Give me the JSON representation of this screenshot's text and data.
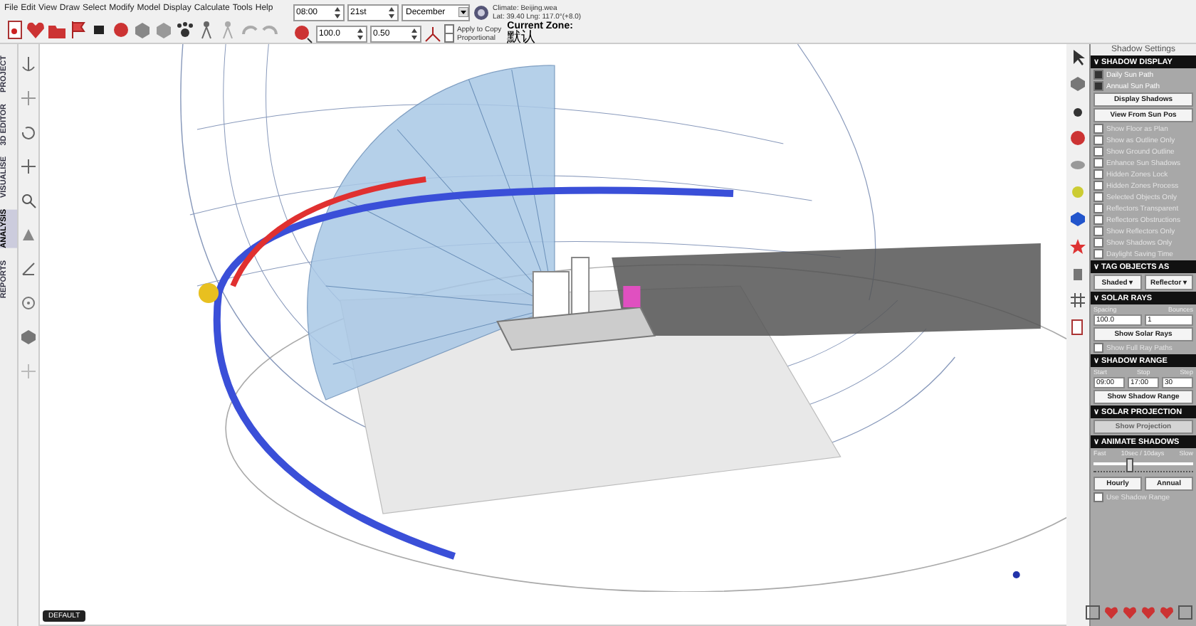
{
  "menu": [
    "File",
    "Edit",
    "View",
    "Draw",
    "Select",
    "Modify",
    "Model",
    "Display",
    "Calculate",
    "Tools",
    "Help"
  ],
  "date": {
    "time": "08:00",
    "day": "21st",
    "month": "December"
  },
  "climate": {
    "file": "Climate: Beijing.wea",
    "location": "Lat: 39.40   Lng: 117.0°(+8.0)"
  },
  "transform": {
    "scale": "100.0",
    "factor": "0.50",
    "apply_to_copy": {
      "label": "Apply to Copy",
      "checked": false
    },
    "proportional": {
      "label": "Proportional",
      "checked": false
    }
  },
  "zone": {
    "label": "Current Zone:",
    "value": "默认"
  },
  "side_tabs": [
    {
      "label": "PROJECT",
      "selected": false
    },
    {
      "label": "3D EDITOR",
      "selected": false
    },
    {
      "label": "VISUALISE",
      "selected": false
    },
    {
      "label": "ANALYSIS",
      "selected": true
    },
    {
      "label": "REPORTS",
      "selected": false
    }
  ],
  "view_tab": "DEFAULT",
  "panel": {
    "title": "Shadow Settings",
    "sections": [
      {
        "title": "∨ SHADOW DISPLAY",
        "items": [
          {
            "kind": "checkbox",
            "label": "Daily Sun Path",
            "checked": true,
            "disabled": false
          },
          {
            "kind": "checkbox",
            "label": "Annual Sun Path",
            "checked": true,
            "disabled": false
          },
          {
            "kind": "button",
            "label": "Display Shadows",
            "disabled": false
          },
          {
            "kind": "button",
            "label": "View From Sun Pos",
            "disabled": false
          },
          {
            "kind": "checkbox",
            "label": "Show Floor as Plan",
            "checked": false,
            "disabled": true
          },
          {
            "kind": "checkbox",
            "label": "Show as Outline Only",
            "checked": false,
            "disabled": true
          },
          {
            "kind": "checkbox",
            "label": "Show Ground Outline",
            "checked": false,
            "disabled": true
          },
          {
            "kind": "checkbox",
            "label": "Enhance Sun Shadows",
            "checked": false,
            "disabled": true
          },
          {
            "kind": "checkbox",
            "label": "Hidden Zones Lock",
            "checked": false,
            "disabled": true
          },
          {
            "kind": "checkbox",
            "label": "Hidden Zones Process",
            "checked": false,
            "disabled": true
          },
          {
            "kind": "checkbox",
            "label": "Selected Objects Only",
            "checked": false,
            "disabled": true
          },
          {
            "kind": "checkbox",
            "label": "Reflectors Transparent",
            "checked": false,
            "disabled": true
          },
          {
            "kind": "checkbox",
            "label": "Reflectors Obstructions",
            "checked": false,
            "disabled": true
          },
          {
            "kind": "checkbox",
            "label": "Show Reflectors Only",
            "checked": false,
            "disabled": true
          },
          {
            "kind": "checkbox",
            "label": "Show Shadows Only",
            "checked": false,
            "disabled": true
          },
          {
            "kind": "checkbox",
            "label": "Daylight Saving Time",
            "checked": false,
            "disabled": true
          }
        ]
      },
      {
        "title": "∨ TAG OBJECTS AS",
        "items": [
          {
            "kind": "menus",
            "labels": [
              "Shaded ▾",
              "Reflector ▾"
            ]
          }
        ]
      },
      {
        "title": "∨ SOLAR RAYS",
        "items": [
          {
            "kind": "fields",
            "fields": [
              {
                "label": "Spacing",
                "value": "100.0"
              },
              {
                "label": "Bounces",
                "value": "1"
              }
            ]
          },
          {
            "kind": "button",
            "label": "Show Solar Rays",
            "disabled": false
          },
          {
            "kind": "checkbox",
            "label": "Show Full Ray Paths",
            "checked": false,
            "disabled": true
          }
        ]
      },
      {
        "title": "∨ SHADOW RANGE",
        "items": [
          {
            "kind": "fields",
            "fields": [
              {
                "label": "Start",
                "value": "09:00"
              },
              {
                "label": "Stop",
                "value": "17:00"
              },
              {
                "label": "Step",
                "value": "30"
              }
            ]
          },
          {
            "kind": "button",
            "label": "Show Shadow Range",
            "disabled": false
          }
        ]
      },
      {
        "title": "∨ SOLAR PROJECTION",
        "items": [
          {
            "kind": "button",
            "label": "Show Projection",
            "disabled": true
          }
        ]
      },
      {
        "title": "∨ ANIMATE SHADOWS",
        "items": [
          {
            "kind": "slider",
            "labels": [
              "Fast",
              "10sec / 10days",
              "Slow"
            ],
            "level": 0.35
          },
          {
            "kind": "buttons",
            "labels": [
              "Hourly",
              "Annual"
            ]
          },
          {
            "kind": "checkbox",
            "label": "Use Shadow Range",
            "checked": false,
            "disabled": true
          }
        ]
      }
    ]
  }
}
